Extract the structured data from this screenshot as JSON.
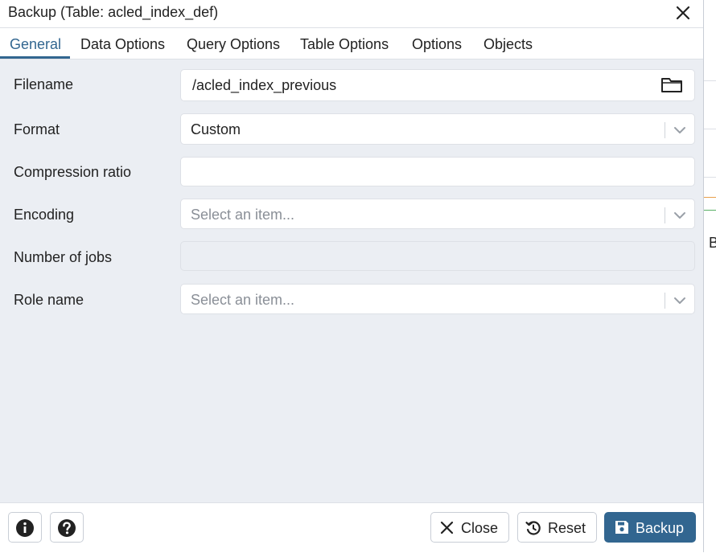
{
  "dialog": {
    "title": "Backup (Table: acled_index_def)"
  },
  "tabs": [
    {
      "label": "General",
      "active": true
    },
    {
      "label": "Data Options"
    },
    {
      "label": "Query Options"
    },
    {
      "label": "Table Options"
    },
    {
      "label": "Options"
    },
    {
      "label": "Objects"
    }
  ],
  "form": {
    "filename": {
      "label": "Filename",
      "value": "/acled_index_previous"
    },
    "format": {
      "label": "Format",
      "value": "Custom"
    },
    "compression": {
      "label": "Compression ratio",
      "value": ""
    },
    "encoding": {
      "label": "Encoding",
      "placeholder": "Select an item..."
    },
    "jobs": {
      "label": "Number of jobs",
      "value": ""
    },
    "role": {
      "label": "Role name",
      "placeholder": "Select an item..."
    }
  },
  "footer": {
    "close_label": "Close",
    "reset_label": "Reset",
    "backup_label": "Backup"
  },
  "background": {
    "partial_letter": "B"
  },
  "colors": {
    "accent": "#326690",
    "dialog_bg": "#ebeef3"
  },
  "icons": [
    "close-icon",
    "folder-icon",
    "chevron-down-icon",
    "info-icon",
    "help-icon",
    "reset-icon",
    "save-icon"
  ]
}
